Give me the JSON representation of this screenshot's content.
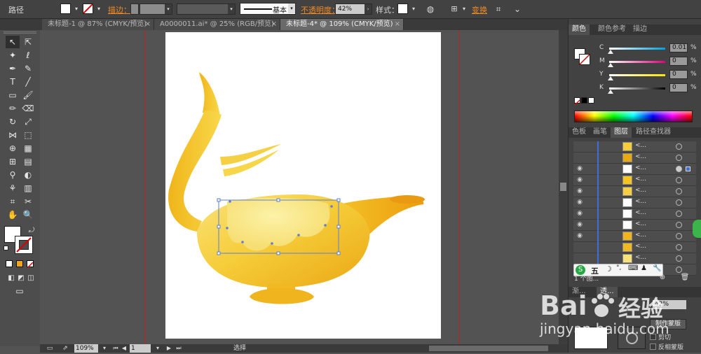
{
  "control_bar": {
    "selection_label": "路径",
    "stroke_label": "描边：",
    "stroke_profile": "基本",
    "opacity_label": "不透明度：",
    "opacity_value": "42%",
    "style_label": "样式：",
    "transform_label": "变换"
  },
  "tabs": [
    {
      "label": "未标题-1 @ 87% (CMYK/预览)",
      "active": false
    },
    {
      "label": "A0000011.ai* @ 25% (RGB/预览)",
      "active": false
    },
    {
      "label": "未标题-4* @ 109% (CMYK/预览)",
      "active": true
    }
  ],
  "tab_close": "×",
  "tools": [
    "selection-tool",
    "direct-selection-tool",
    "magic-wand-tool",
    "lasso-tool",
    "pen-tool",
    "curvature-tool",
    "type-tool",
    "line-segment-tool",
    "rectangle-tool",
    "paintbrush-tool",
    "pencil-tool",
    "eraser-tool",
    "rotate-tool",
    "scale-tool",
    "width-tool",
    "free-transform-tool",
    "shape-builder-tool",
    "perspective-grid-tool",
    "mesh-tool",
    "gradient-tool",
    "eyedropper-tool",
    "blend-tool",
    "symbol-sprayer-tool",
    "column-graph-tool",
    "artboard-tool",
    "slice-tool",
    "hand-tool",
    "zoom-tool"
  ],
  "color_panel": {
    "tabs": [
      "颜色",
      "颜色参考",
      "描边"
    ],
    "sliders": [
      {
        "label": "C",
        "value": "0.01",
        "pct": "%",
        "track": "linear-gradient(90deg,#fff,#00a0e0)"
      },
      {
        "label": "M",
        "value": "0",
        "pct": "%",
        "track": "linear-gradient(90deg,#fff,#e0007a)"
      },
      {
        "label": "Y",
        "value": "0",
        "pct": "%",
        "track": "linear-gradient(90deg,#fff,#ffe400)"
      },
      {
        "label": "K",
        "value": "0",
        "pct": "%",
        "track": "linear-gradient(90deg,#fff,#000)"
      }
    ]
  },
  "layers_panel": {
    "tabs": [
      "色板",
      "画笔",
      "图层",
      "路径查找器"
    ],
    "row_names": [
      "<...",
      "<...",
      "<...",
      "<...",
      "<...",
      "<...",
      "<...",
      "<...",
      "<...",
      "<...",
      "<...",
      "<..."
    ],
    "status": "1 个图..."
  },
  "transparency_panel": {
    "tabs": [
      "渐...",
      "透..."
    ],
    "opacity_value": "42%",
    "make_mask_button": "制作蒙版",
    "clip_label": "剪切",
    "invert_mask_label": "反相蒙版"
  },
  "ime": {
    "label": "五"
  },
  "watermark": {
    "brand": "Bai",
    "brand2": "经验",
    "url": "jingyan.baidu.com"
  },
  "status_bar": {
    "zoom": "109%",
    "page": "1",
    "tool_name": "选择"
  },
  "colors": {
    "lamp_light": "#fbe98a",
    "lamp_mid": "#f4c520",
    "lamp_dark": "#e9a712",
    "selection": "#5a7fd8",
    "guide": "#b22222"
  }
}
